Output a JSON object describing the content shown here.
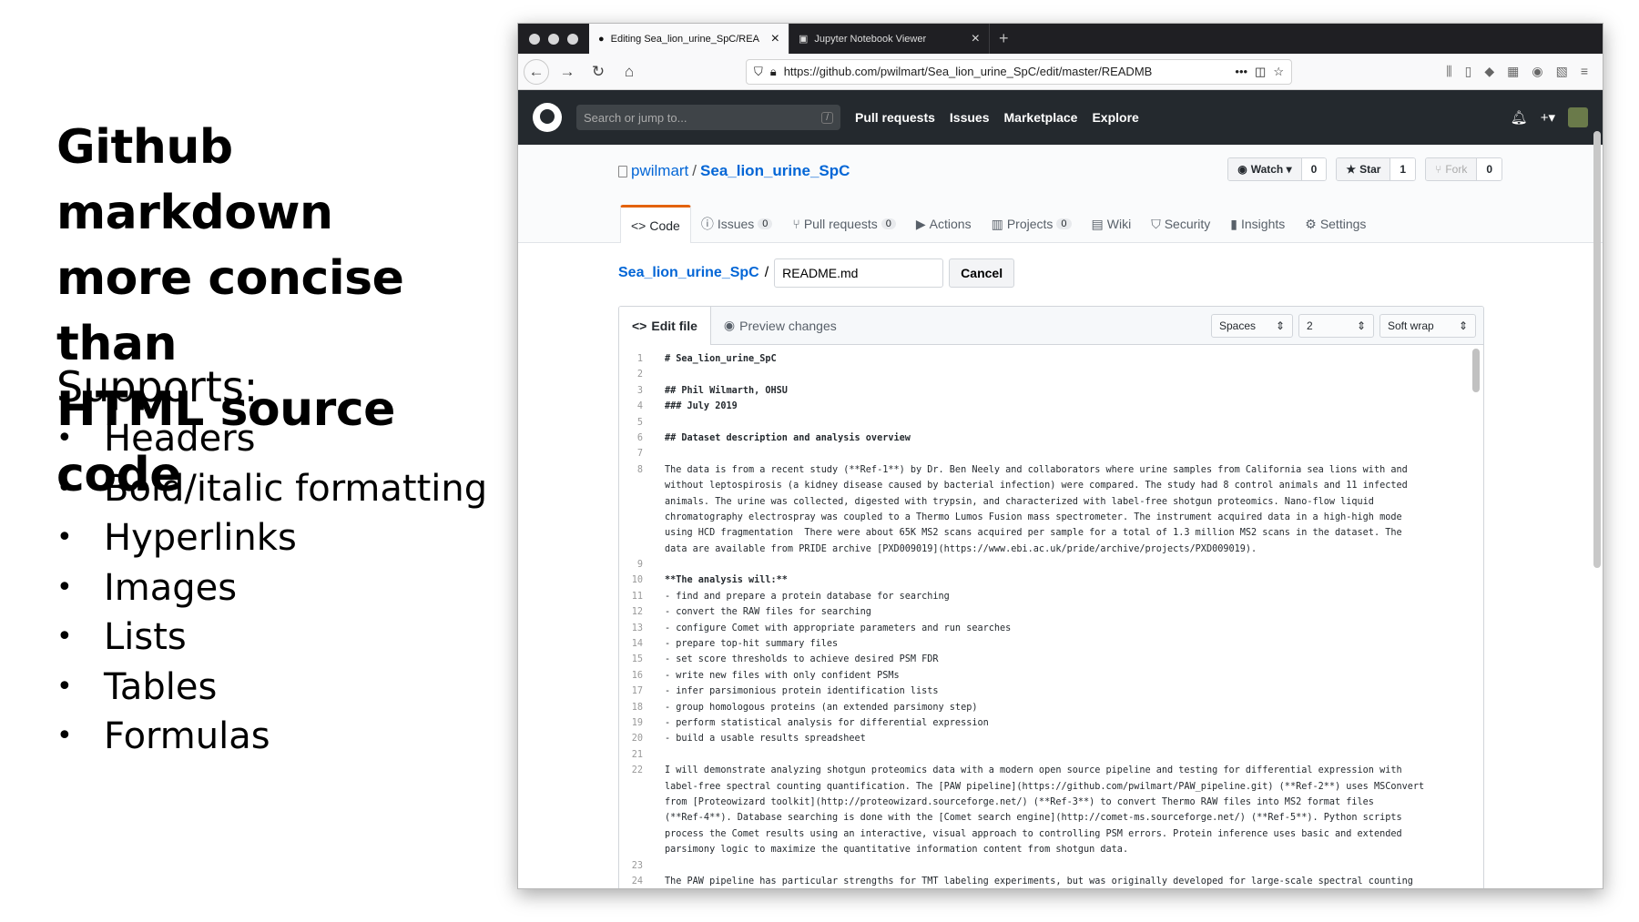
{
  "slide": {
    "title_lines": [
      "Github markdown",
      "more concise than",
      "HTML source code"
    ],
    "supports_label": "Supports:",
    "bullets": [
      "Headers",
      "Bold/italic formatting",
      "Hyperlinks",
      "Images",
      "Lists",
      "Tables",
      "Formulas"
    ]
  },
  "browser": {
    "tabs": [
      {
        "label": "Editing Sea_lion_urine_SpC/REA",
        "icon": "github-icon",
        "active": true
      },
      {
        "label": "Jupyter Notebook Viewer",
        "icon": "jupyter-icon",
        "active": false
      }
    ],
    "new_tab": "+",
    "url": "https://github.com/pwilmart/Sea_lion_urine_SpC/edit/master/READMB",
    "url_more": "•••"
  },
  "github": {
    "search_placeholder": "Search or jump to...",
    "search_key": "/",
    "nav": [
      "Pull requests",
      "Issues",
      "Marketplace",
      "Explore"
    ],
    "owner": "pwilmart",
    "separator": "/",
    "repo": "Sea_lion_urine_SpC",
    "actions": [
      {
        "label": "Watch ▾",
        "count": "0",
        "icon": "eye-icon"
      },
      {
        "label": "Star",
        "count": "1",
        "icon": "star-icon"
      },
      {
        "label": "Fork",
        "count": "0",
        "icon": "fork-icon"
      }
    ],
    "tabs": [
      {
        "label": "Code",
        "count": null,
        "icon": "<>"
      },
      {
        "label": "Issues",
        "count": "0",
        "icon": "ⓘ"
      },
      {
        "label": "Pull requests",
        "count": "0",
        "icon": "⑂"
      },
      {
        "label": "Actions",
        "count": null,
        "icon": "▶"
      },
      {
        "label": "Projects",
        "count": "0",
        "icon": "▥"
      },
      {
        "label": "Wiki",
        "count": null,
        "icon": "▤"
      },
      {
        "label": "Security",
        "count": null,
        "icon": "⛉"
      },
      {
        "label": "Insights",
        "count": null,
        "icon": "▮"
      },
      {
        "label": "Settings",
        "count": null,
        "icon": "⚙"
      }
    ]
  },
  "editor": {
    "path_repo": "Sea_lion_urine_SpC",
    "path_sep": "/",
    "filename": "README.md",
    "cancel": "Cancel",
    "tab_edit": "Edit file",
    "tab_preview": "Preview changes",
    "indent_mode": "Spaces",
    "indent_size": "2",
    "wrap_mode": "Soft wrap",
    "lines": [
      {
        "n": "1",
        "t": "# Sea_lion_urine_SpC",
        "b": true
      },
      {
        "n": "2",
        "t": "",
        "b": false
      },
      {
        "n": "3",
        "t": "## Phil Wilmarth, OHSU",
        "b": true
      },
      {
        "n": "4",
        "t": "### July 2019",
        "b": true
      },
      {
        "n": "5",
        "t": "",
        "b": false
      },
      {
        "n": "6",
        "t": "## Dataset description and analysis overview",
        "b": true
      },
      {
        "n": "7",
        "t": "",
        "b": false
      },
      {
        "n": "8",
        "t": "The data is from a recent study (**Ref-1**) by Dr. Ben Neely and collaborators where urine samples from California sea lions with and",
        "b": false
      },
      {
        "n": "",
        "t": "without leptospirosis (a kidney disease caused by bacterial infection) were compared. The study had 8 control animals and 11 infected",
        "b": false
      },
      {
        "n": "",
        "t": "animals. The urine was collected, digested with trypsin, and characterized with label-free shotgun proteomics. Nano-flow liquid",
        "b": false
      },
      {
        "n": "",
        "t": "chromatography electrospray was coupled to a Thermo Lumos Fusion mass spectrometer. The instrument acquired data in a high-high mode",
        "b": false
      },
      {
        "n": "",
        "t": "using HCD fragmentation  There were about 65K MS2 scans acquired per sample for a total of 1.3 million MS2 scans in the dataset. The",
        "b": false
      },
      {
        "n": "",
        "t": "data are available from PRIDE archive [PXD009019](https://www.ebi.ac.uk/pride/archive/projects/PXD009019).",
        "b": false
      },
      {
        "n": "9",
        "t": "",
        "b": false
      },
      {
        "n": "10",
        "t": "**The analysis will:**",
        "b": true
      },
      {
        "n": "11",
        "t": "- find and prepare a protein database for searching",
        "b": false
      },
      {
        "n": "12",
        "t": "- convert the RAW files for searching",
        "b": false
      },
      {
        "n": "13",
        "t": "- configure Comet with appropriate parameters and run searches",
        "b": false
      },
      {
        "n": "14",
        "t": "- prepare top-hit summary files",
        "b": false
      },
      {
        "n": "15",
        "t": "- set score thresholds to achieve desired PSM FDR",
        "b": false
      },
      {
        "n": "16",
        "t": "- write new files with only confident PSMs",
        "b": false
      },
      {
        "n": "17",
        "t": "- infer parsimonious protein identification lists",
        "b": false
      },
      {
        "n": "18",
        "t": "- group homologous proteins (an extended parsimony step)",
        "b": false
      },
      {
        "n": "19",
        "t": "- perform statistical analysis for differential expression",
        "b": false
      },
      {
        "n": "20",
        "t": "- build a usable results spreadsheet",
        "b": false
      },
      {
        "n": "21",
        "t": "",
        "b": false
      },
      {
        "n": "22",
        "t": "I will demonstrate analyzing shotgun proteomics data with a modern open source pipeline and testing for differential expression with",
        "b": false
      },
      {
        "n": "",
        "t": "label-free spectral counting quantification. The [PAW pipeline](https://github.com/pwilmart/PAW_pipeline.git) (**Ref-2**) uses MSConvert",
        "b": false
      },
      {
        "n": "",
        "t": "from [Proteowizard toolkit](http://proteowizard.sourceforge.net/) (**Ref-3**) to convert Thermo RAW files into MS2 format files",
        "b": false
      },
      {
        "n": "",
        "t": "(**Ref-4**). Database searching is done with the [Comet search engine](http://comet-ms.sourceforge.net/) (**Ref-5**). Python scripts",
        "b": false
      },
      {
        "n": "",
        "t": "process the Comet results using an interactive, visual approach to controlling PSM errors. Protein inference uses basic and extended",
        "b": false
      },
      {
        "n": "",
        "t": "parsimony logic to maximize the quantitative information content from shotgun data.",
        "b": false
      },
      {
        "n": "23",
        "t": "",
        "b": false
      },
      {
        "n": "24",
        "t": "The PAW pipeline has particular strengths for TMT labeling experiments, but was originally developed for large-scale spectral counting",
        "b": false
      }
    ]
  }
}
